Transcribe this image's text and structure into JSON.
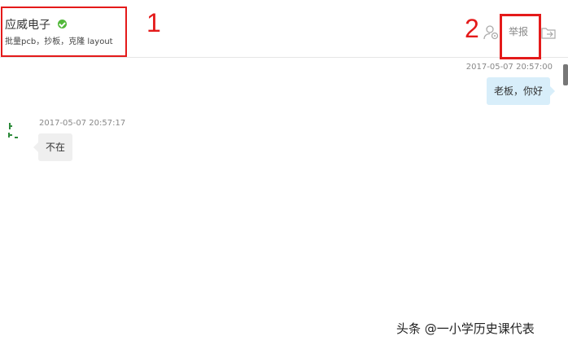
{
  "header": {
    "shop_name": "应威电子",
    "shop_desc": "批量pcb，抄板，克隆 layout",
    "annotation_1": "1",
    "annotation_2": "2",
    "report_label": "举报",
    "icons": [
      "user-settings-icon",
      "share-icon",
      "verified-icon"
    ]
  },
  "messages": [
    {
      "side": "right",
      "timestamp": "2017-05-07 20:57:00",
      "text": "老板，你好"
    },
    {
      "side": "left",
      "timestamp": "2017-05-07 20:57:17",
      "text": "不在"
    }
  ],
  "watermark": "头条 @一小学历史课代表",
  "colors": {
    "annotation": "#e41a1a",
    "verified": "#52b83a",
    "bubble_self": "#d8eefa",
    "bubble_other": "#efefef"
  }
}
